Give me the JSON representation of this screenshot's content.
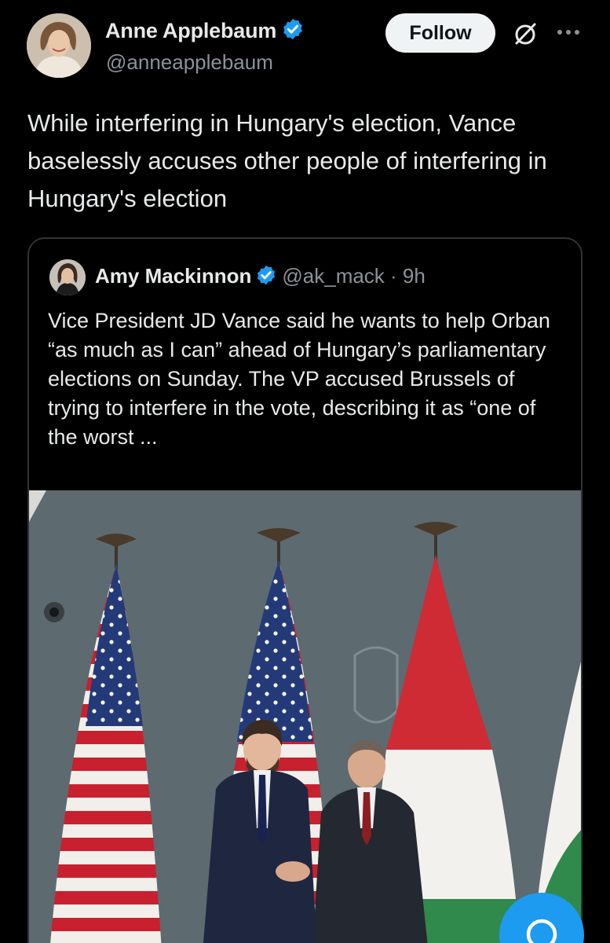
{
  "author": {
    "name": "Anne Applebaum",
    "handle": "@anneapplebaum",
    "avatar_icon": "profile-photo",
    "verified_icon": "verified-badge-icon"
  },
  "actions": {
    "follow_label": "Follow",
    "grok_icon": "grok-icon",
    "more_icon": "more-icon"
  },
  "tweet": {
    "text": "While interfering in Hungary's election, Vance baselessly accuses other people of interfering in Hungary's election"
  },
  "quoted": {
    "name": "Amy Mackinnon",
    "handle": "@ak_mack",
    "time": "· 9h",
    "text": "Vice President JD Vance said he wants to help Orban “as much as I can” ahead of Hungary’s parliamentary elections on Sunday. The VP accused Brussels of trying to interfere in the vote, describing it as “one of the worst ...",
    "media_icon": "flags-handshake-photo"
  },
  "colors": {
    "background": "#000000",
    "text": "#e7e9ea",
    "muted": "#8b9298",
    "accent": "#1d9bf0",
    "border": "#2f3336"
  },
  "compose_icon": "compose-post-icon"
}
